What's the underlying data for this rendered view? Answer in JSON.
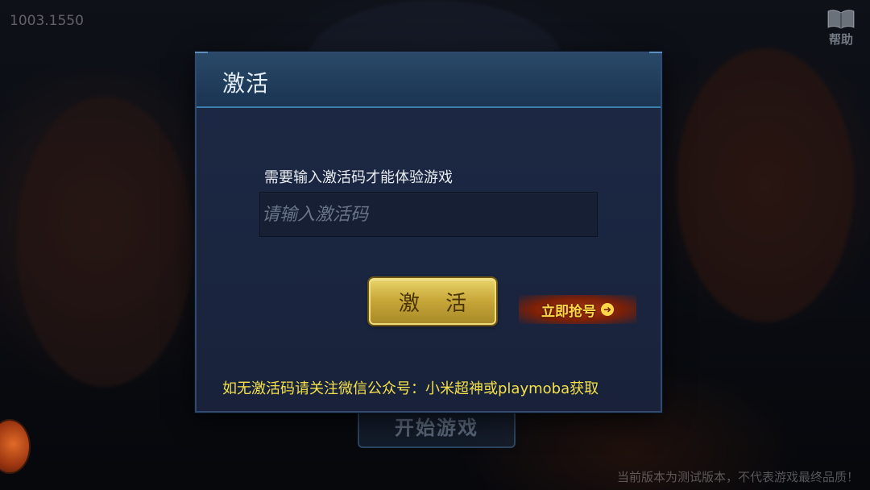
{
  "app": {
    "version_text": "1003.1550",
    "help_label": "帮助",
    "background_button_label": "开始游戏",
    "disclaimer": "当前版本为测试版本，不代表游戏最终品质！"
  },
  "dialog": {
    "title": "激活",
    "prompt": "需要输入激活码才能体验游戏",
    "input_value": "",
    "input_placeholder": "请输入激活码",
    "activate_label": "激 活",
    "grab_code_label": "立即抢号",
    "footer_note": "如无激活码请关注微信公众号：小米超神或playmoba获取"
  },
  "icons": {
    "help": "book-icon",
    "grab_arrow": "arrow-right-circle-icon",
    "chest": "treasure-chest-icon"
  },
  "colors": {
    "dialog_bg": "#1d2a44",
    "header_accent": "#3c7eae",
    "activate_gold": "#c9a93a",
    "footer_yellow": "#f3e04a",
    "grab_red": "#b03812"
  }
}
